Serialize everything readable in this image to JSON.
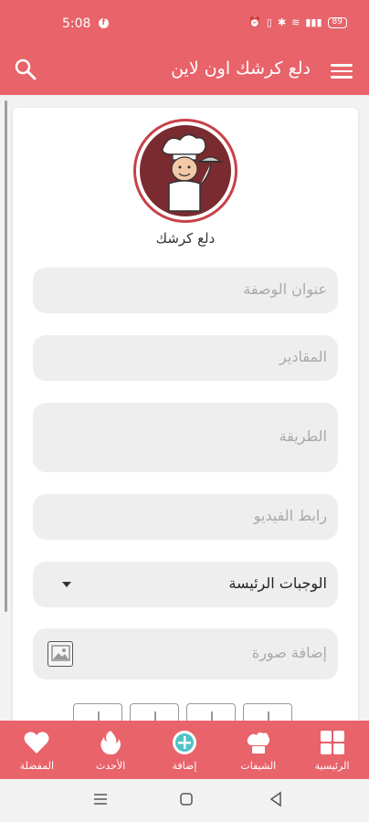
{
  "status_bar": {
    "time": "5:08",
    "battery": "89"
  },
  "app_bar": {
    "title": "دلع كرشك اون لاين"
  },
  "logo": {
    "name": "دلع كرشك"
  },
  "form": {
    "recipe_title_placeholder": "عنوان الوصفة",
    "ingredients_placeholder": "المقادير",
    "method_placeholder": "الطريقة",
    "video_link_placeholder": "رابط الفيديو",
    "category_selected": "الوجبات الرئيسة",
    "add_image_placeholder": "إضافة صورة"
  },
  "bottom_nav": {
    "items": [
      {
        "label": "الرئيسية",
        "icon": "grid-icon"
      },
      {
        "label": "الشيفات",
        "icon": "chef-hat-icon"
      },
      {
        "label": "إضافة",
        "icon": "add-circle-icon"
      },
      {
        "label": "الأحدث",
        "icon": "fire-icon"
      },
      {
        "label": "المفضلة",
        "icon": "heart-icon"
      }
    ]
  },
  "colors": {
    "primary": "#e8636a",
    "field_bg": "#eeeeee",
    "placeholder": "#a9a9a9",
    "add_accent": "#4fc3c7"
  }
}
